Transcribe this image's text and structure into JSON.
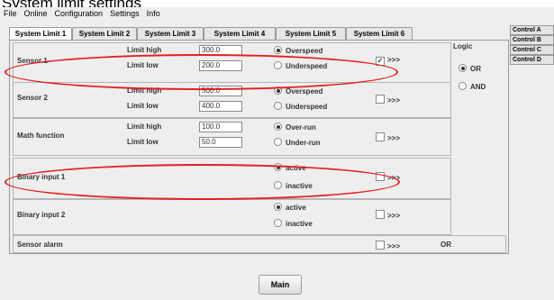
{
  "caption": "System limit settings",
  "menu": [
    "File",
    "Online",
    "Configuration",
    "Settings",
    "Info"
  ],
  "tabs": [
    "System Limit 1",
    "System Limit 2",
    "System Limit 3",
    "System Limit 4",
    "System Limit 5",
    "System Limit 6"
  ],
  "right_buttons": [
    "Control A",
    "Control B",
    "Control C",
    "Control D"
  ],
  "labels": {
    "limit_high": "Limit high",
    "limit_low": "Limit low"
  },
  "sensor1": {
    "name": "Sensor 1",
    "high": "300.0",
    "low": "200.0",
    "opt_a": "Overspeed",
    "opt_b": "Underspeed",
    "arrows": ">>>"
  },
  "sensor2": {
    "name": "Sensor 2",
    "high": "500.0",
    "low": "400.0",
    "opt_a": "Overspeed",
    "opt_b": "Underspeed",
    "arrows": ">>>"
  },
  "math": {
    "name": "Math function",
    "high": "100.0",
    "low": "50.0",
    "opt_a": "Over-run",
    "opt_b": "Under-run",
    "arrows": ">>>"
  },
  "binary1": {
    "name": "Binary input 1",
    "opt_a": "active",
    "opt_b": "inactive",
    "arrows": ">>>"
  },
  "binary2": {
    "name": "Binary input 2",
    "opt_a": "active",
    "opt_b": "inactive",
    "arrows": ">>>"
  },
  "alarm": {
    "name": "Sensor alarm",
    "arrows": ">>>",
    "logic_value": "OR"
  },
  "logic": {
    "title": "Logic",
    "or": "OR",
    "and": "AND"
  },
  "checkbox_mark": "✓",
  "main_button": "Main"
}
